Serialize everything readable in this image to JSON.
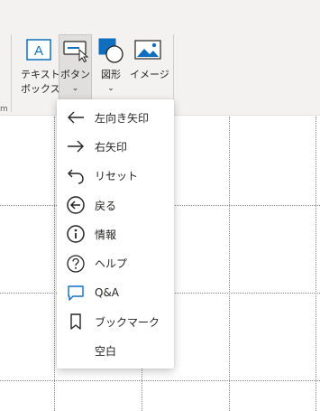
{
  "ribbon": {
    "textbox_label_line1": "テキスト",
    "textbox_label_line2": "ボックス",
    "button_label": "ボタン",
    "shape_label": "図形",
    "image_label": "イメージ",
    "group_stub": "m",
    "chevron": "⌄"
  },
  "menu": {
    "items": [
      {
        "label": "左向き矢印",
        "icon": "arrow-left-icon"
      },
      {
        "label": "右矢印",
        "icon": "arrow-right-icon"
      },
      {
        "label": "リセット",
        "icon": "reset-icon"
      },
      {
        "label": "戻る",
        "icon": "back-circle-icon"
      },
      {
        "label": "情報",
        "icon": "info-icon"
      },
      {
        "label": "ヘルプ",
        "icon": "help-icon"
      },
      {
        "label": "Q&A",
        "icon": "qna-icon"
      },
      {
        "label": "ブックマーク",
        "icon": "bookmark-icon"
      },
      {
        "label": "空白",
        "icon": ""
      }
    ]
  },
  "colors": {
    "accent": "#106ebe",
    "ribbon_bg": "#f3f2f1",
    "icon_stroke": "#252423"
  }
}
